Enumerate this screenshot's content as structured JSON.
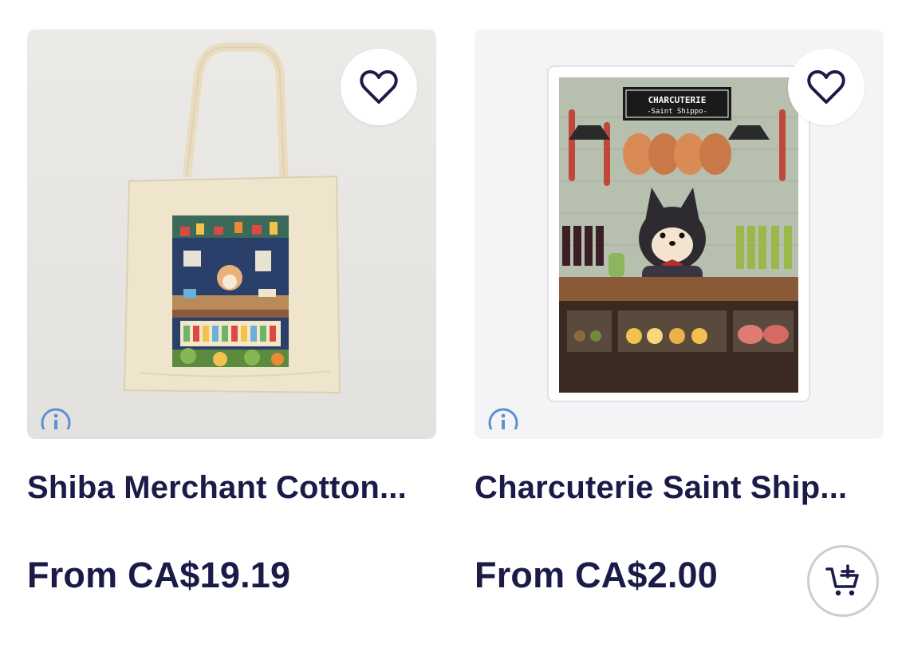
{
  "products": [
    {
      "title": "Shiba Merchant Cotton...",
      "price": "From CA$19.19",
      "image_alt": "Tote bag with illustrated shiba merchant shop",
      "favorite_icon": "heart-outline-icon",
      "info_icon": "info-icon"
    },
    {
      "title": "Charcuterie Saint Ship...",
      "price": "From CA$2.00",
      "image_alt": "Sticker of shiba at charcuterie counter",
      "favorite_icon": "heart-outline-icon",
      "info_icon": "info-icon",
      "cart_icon": "add-to-cart-icon"
    }
  ],
  "sticker_art": {
    "sign_line1": "CHARCUTERIE",
    "sign_line2": "-Saint Shippo-"
  },
  "colors": {
    "text": "#1b1b4a",
    "info_blue": "#5b8fd6",
    "cart_border": "#c9cdd6"
  }
}
